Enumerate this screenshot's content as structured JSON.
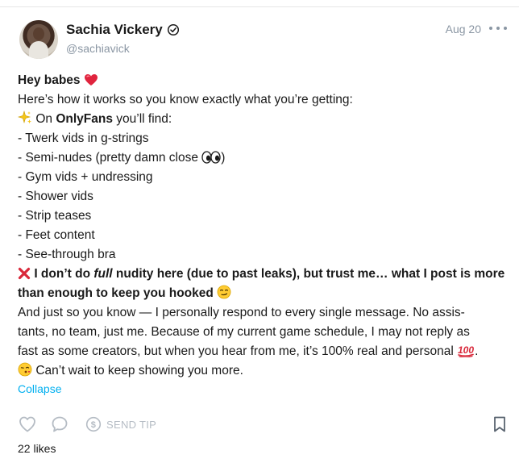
{
  "post": {
    "author": {
      "display_name": "Sachia Vickery",
      "handle": "@sachiavick",
      "verified_icon": "verified-check-icon"
    },
    "date": "Aug 20",
    "greeting": "Hey babes",
    "intro": "Here’s how it works so you know exactly what you’re getting:",
    "on_prefix": "On",
    "platform": "OnlyFans",
    "on_suffix": "you’ll find:",
    "list_items": [
      "- Twerk vids in g-strings",
      "- Semi-nudes (pretty damn close",
      "- Gym vids + undressing",
      "- Shower vids",
      "- Strip teases",
      "- Feet content",
      "- See-through bra"
    ],
    "list_item_semi_suffix": ")",
    "disclaimer_a": "I don’t do",
    "disclaimer_em": "full",
    "disclaimer_b": "nudity here (due to past leaks), but trust me… what I post is more",
    "disclaimer_c": "than enough to keep you hooked",
    "para_line1": "And just so you know — I personally respond to every single message. No assis-",
    "para_line2": "tants, no team, just me. Because of my current game schedule, I may not reply as",
    "para_line3": "fast as some creators, but when you hear from me, it’s 100% real and personal",
    "para_line3_end": ".",
    "closing": "Can’t wait to keep showing you more.",
    "collapse_label": "Collapse",
    "tip_label": "SEND TIP",
    "likes": "22 likes"
  },
  "colors": {
    "accent": "#00aff0",
    "muted": "#8a96a3",
    "text": "#1a1a1a"
  },
  "icons": [
    "verified-check-icon",
    "more-options-icon",
    "heart-icon",
    "comment-icon",
    "dollar-icon",
    "bookmark-icon",
    "sparkles-icon",
    "eyes-icon",
    "red-x-icon",
    "smirk-icon",
    "hundred-icon",
    "kiss-icon",
    "red-heart-icon"
  ]
}
